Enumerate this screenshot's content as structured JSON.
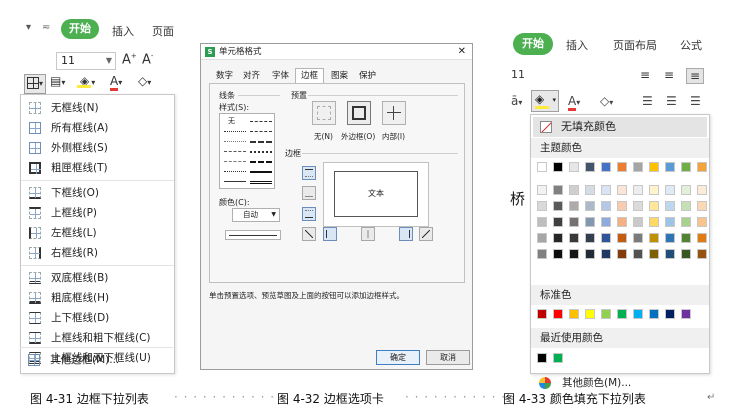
{
  "panel1": {
    "tabs": {
      "start": "开始",
      "insert": "插入",
      "layout": "页面"
    },
    "font_size": "11",
    "menu_items": [
      {
        "label": "无框线(N)"
      },
      {
        "label": "所有框线(A)"
      },
      {
        "label": "外侧框线(S)"
      },
      {
        "label": "粗匣框线(T)"
      },
      {
        "label": "下框线(O)"
      },
      {
        "label": "上框线(P)"
      },
      {
        "label": "左框线(L)"
      },
      {
        "label": "右框线(R)"
      },
      {
        "label": "双底框线(B)"
      },
      {
        "label": "粗底框线(H)"
      },
      {
        "label": "上下框线(D)"
      },
      {
        "label": "上框线和粗下框线(C)"
      },
      {
        "label": "上框线和双下框线(U)"
      },
      {
        "label": "其他边框(M)..."
      }
    ]
  },
  "panel2": {
    "title": "单元格格式",
    "tabs": [
      "数字",
      "对齐",
      "字体",
      "边框",
      "图案",
      "保护"
    ],
    "active_tab": "边框",
    "line_group": "线条",
    "style_label": "样式(S):",
    "style_none": "无",
    "color_label": "颜色(C):",
    "color_value": "自动",
    "preset_group": "预置",
    "presets": [
      "无(N)",
      "外边框(O)",
      "内部(I)"
    ],
    "border_group": "边框",
    "preview_text": "文本",
    "note": "单击预置选项、预览草图及上面的按钮可以添加边框样式。",
    "ok": "确定",
    "cancel": "取消"
  },
  "panel3": {
    "tabs": {
      "start": "开始",
      "insert": "插入",
      "layout": "页面布局",
      "formula": "公式"
    },
    "font_size": "11",
    "no_fill": "无填充颜色",
    "theme_colors_label": "主题颜色",
    "theme_top": [
      "#ffffff",
      "#000000",
      "#e7e6e6",
      "#44546a",
      "#4472c4",
      "#ed7d31",
      "#a5a5a5",
      "#ffc000",
      "#5b9bd5",
      "#70ad47",
      "#f3a33b"
    ],
    "theme_cols": [
      [
        "#f2f2f2",
        "#d9d9d9",
        "#bfbfbf",
        "#a6a6a6",
        "#808080"
      ],
      [
        "#808080",
        "#595959",
        "#404040",
        "#262626",
        "#0d0d0d"
      ],
      [
        "#d0cece",
        "#aeaaaa",
        "#757171",
        "#3a3838",
        "#171616"
      ],
      [
        "#d6dce4",
        "#adb9ca",
        "#8497b0",
        "#333f4f",
        "#222a35"
      ],
      [
        "#dae3f3",
        "#b4c7e7",
        "#8faadc",
        "#2f5597",
        "#203864"
      ],
      [
        "#fbe5d6",
        "#f8cbad",
        "#f4b183",
        "#c55a11",
        "#843c0c"
      ],
      [
        "#ededed",
        "#dbdbdb",
        "#c9c9c9",
        "#7b7b7b",
        "#525252"
      ],
      [
        "#fff2cc",
        "#ffe699",
        "#ffd966",
        "#bf9000",
        "#7f6000"
      ],
      [
        "#deebf7",
        "#bdd7ee",
        "#9dc3e6",
        "#2e75b6",
        "#1f4e79"
      ],
      [
        "#e2f0d9",
        "#c5e0b4",
        "#a9d18e",
        "#548235",
        "#385723"
      ],
      [
        "#fdebd9",
        "#fbd7b3",
        "#f8c38d",
        "#e07b14",
        "#955210"
      ]
    ],
    "standard_label": "标准色",
    "standard": [
      "#c00000",
      "#ff0000",
      "#ffc000",
      "#ffff00",
      "#92d050",
      "#00b050",
      "#00b0f0",
      "#0070c0",
      "#002060",
      "#7030a0"
    ],
    "recent_label": "最近使用颜色",
    "recent": [
      "#000000",
      "#00b050"
    ],
    "more": "其他颜色(M)...",
    "doc_fragment": "桥"
  },
  "captions": {
    "c1": "图 4-31 边框下拉列表",
    "c2": "图 4-32 边框选项卡",
    "c3": "图 4-33 颜色填充下拉列表"
  }
}
